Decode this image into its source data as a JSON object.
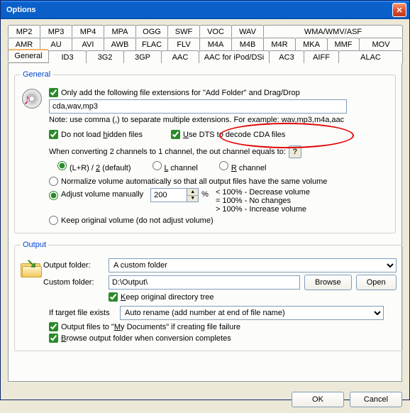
{
  "window": {
    "title": "Options",
    "close": "✕"
  },
  "tabs_row1": [
    "MP2",
    "MP3",
    "MP4",
    "MPA",
    "OGG",
    "SWF",
    "VOC",
    "WAV",
    "WMA/WMV/ASF"
  ],
  "tabs_row2": [
    "AMR",
    "AU",
    "AVI",
    "AWB",
    "FLAC",
    "FLV",
    "M4A",
    "M4B",
    "M4R",
    "MKA",
    "MMF",
    "MOV"
  ],
  "tabs_row3": [
    "General",
    "ID3",
    "3G2",
    "3GP",
    "AAC",
    "AAC for iPod/DSi",
    "AC3",
    "AIFF",
    "ALAC"
  ],
  "general": {
    "legend": "General",
    "only_add_label": "Only add the following file extensions for \"Add Folder\" and Drag/Drop",
    "ext_value": "cda,wav,mp3",
    "ext_note": "Note: use comma (,) to separate multiple extensions. For example: wav,mp3,m4a,aac",
    "no_hidden_pre": "Do not load ",
    "no_hidden_u": "h",
    "no_hidden_post": "idden files",
    "dts_pre": "",
    "dts_u": "U",
    "dts_post": "se DTS to decode CDA files",
    "channel_row": "When converting 2 channels to 1 channel, the out channel equals to:",
    "help": "?",
    "ch_lr_pre": "(L+R) / ",
    "ch_lr_u": "2",
    "ch_lr_post": " (default)",
    "ch_l_u": "L",
    "ch_l_post": " channel",
    "ch_r_u": "R",
    "ch_r_post": " channel",
    "norm": "Normalize volume automatically so that all output files have the same volume",
    "adj": "Adjust volume manually",
    "adj_val": "200",
    "adj_pct": "%",
    "hint1": "< 100% - Decrease volume",
    "hint2": "= 100% - No changes",
    "hint3": "> 100% - Increase volume",
    "keep": "Keep original volume (do not adjust volume)"
  },
  "output": {
    "legend": "Output",
    "folder_label": "Output folder:",
    "folder_value": "A custom folder",
    "custom_label": "Custom folder:",
    "custom_value": "D:\\Output\\",
    "browse": "Browse",
    "open": "Open",
    "keep_tree_u": "K",
    "keep_tree_post": "eep original directory tree",
    "target_label": "If target file exists",
    "target_value": "Auto rename (add number at end of file name)",
    "mydocs_pre": "Output files to \"",
    "mydocs_u": "M",
    "mydocs_post": "y Documents\" if creating file failure",
    "browse_done_u": "B",
    "browse_done_post": "rowse output folder when conversion completes"
  },
  "footer": {
    "ok": "OK",
    "cancel": "Cancel"
  }
}
